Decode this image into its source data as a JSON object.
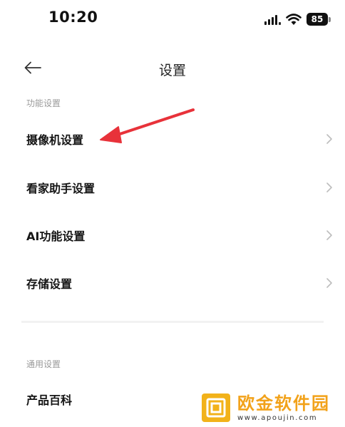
{
  "status_bar": {
    "time": "10:20",
    "battery_level": "85"
  },
  "nav": {
    "title": "设置"
  },
  "sections": [
    {
      "label": "功能设置",
      "items": [
        {
          "label": "摄像机设置"
        },
        {
          "label": "看家助手设置"
        },
        {
          "label": "AI功能设置"
        },
        {
          "label": "存储设置"
        }
      ]
    },
    {
      "label": "通用设置",
      "items": [
        {
          "label": "产品百科"
        }
      ]
    }
  ],
  "colors": {
    "annotation_arrow": "#e8323a",
    "section_label": "#9a9a9a",
    "chevron": "#bdbdbd",
    "watermark": "#f2b21a"
  },
  "watermark": {
    "brand": "欧金软件园",
    "url": "www.apoujin.com"
  }
}
